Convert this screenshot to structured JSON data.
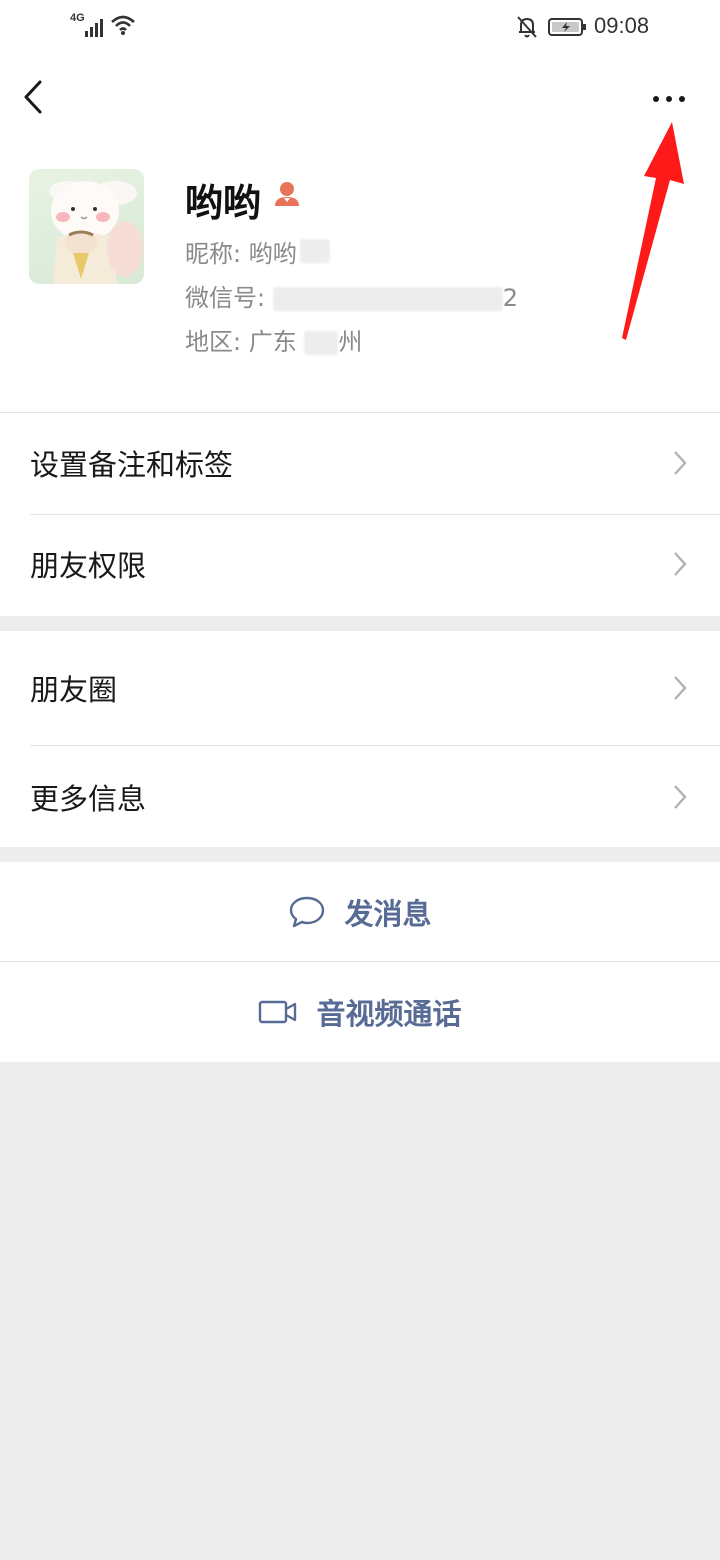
{
  "status_bar": {
    "network": "4G",
    "time": "09:08"
  },
  "profile": {
    "name": "哟哟",
    "nickname_line": "昵称: 哟哟",
    "wechat_id_prefix": "微信号: ",
    "wechat_id_tail": "2",
    "region_prefix": "地区: 广东  ",
    "region_tail": "州"
  },
  "menu_group_1": [
    {
      "label": "设置备注和标签"
    },
    {
      "label": "朋友权限"
    }
  ],
  "menu_group_2": [
    {
      "label": "朋友圈"
    },
    {
      "label": "更多信息"
    }
  ],
  "actions": {
    "message": "发消息",
    "call": "音视频通话"
  },
  "colors": {
    "link": "#576b95",
    "badge": "#e8735a",
    "annotation_arrow": "#ff1a1a",
    "page_bg": "#ededed"
  },
  "icons": [
    "back-icon",
    "more-dots-icon",
    "person-badge-icon",
    "chevron-right-icon",
    "chat-bubble-icon",
    "video-camera-icon"
  ]
}
